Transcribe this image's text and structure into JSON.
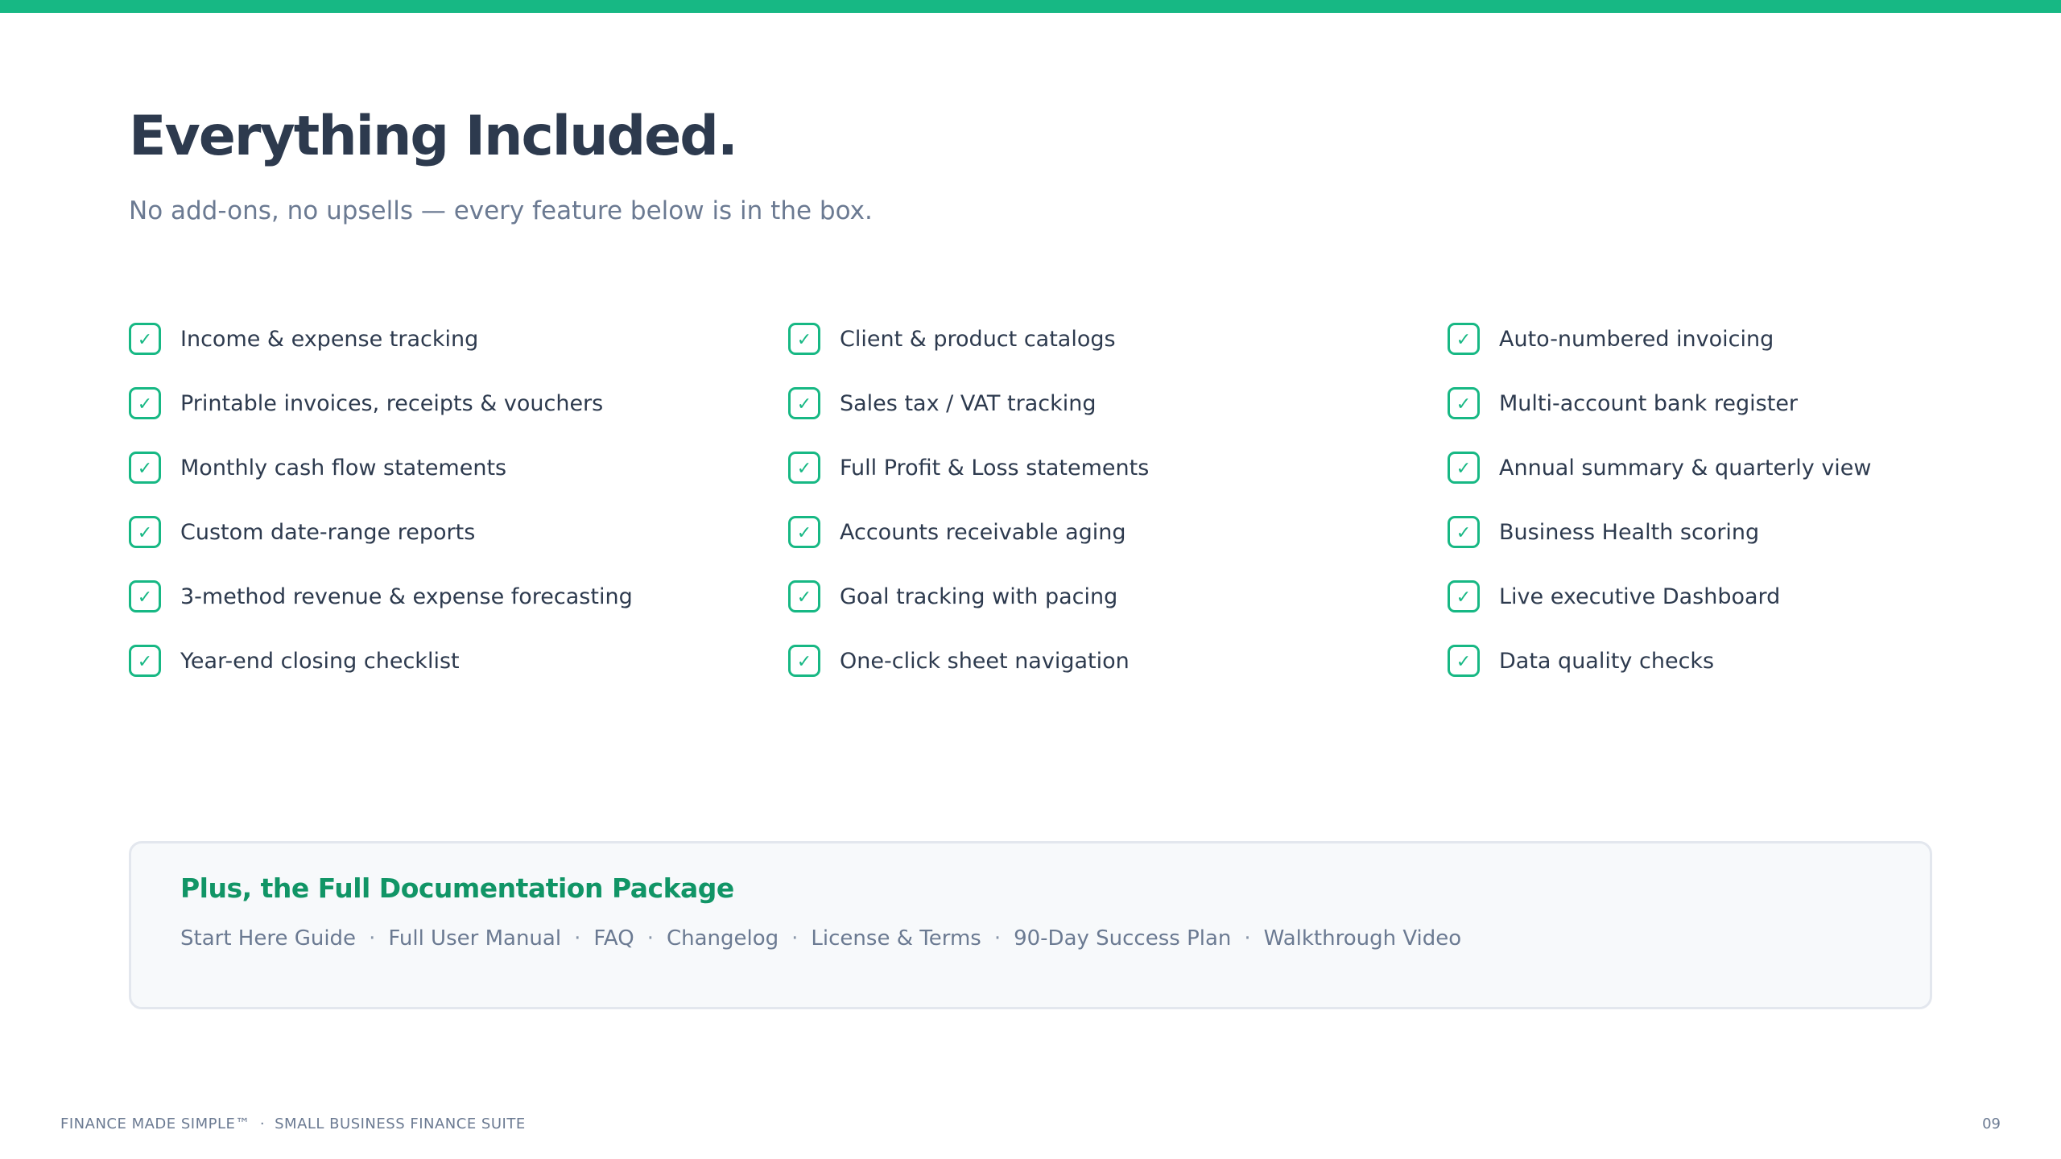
{
  "header": {
    "title": "Everything Included.",
    "subtitle": "No add-ons, no upsells — every feature below is in the box."
  },
  "features": {
    "check_glyph": "✓",
    "items": [
      "Income & expense tracking",
      "Client & product catalogs",
      "Auto-numbered invoicing",
      "Printable invoices, receipts & vouchers",
      "Sales tax / VAT tracking",
      "Multi-account bank register",
      "Monthly cash flow statements",
      "Full Profit & Loss statements",
      "Annual summary & quarterly view",
      "Custom date-range reports",
      "Accounts receivable aging",
      "Business Health scoring",
      "3-method revenue & expense forecasting",
      "Goal tracking with pacing",
      "Live executive Dashboard",
      "Year-end closing checklist",
      "One-click sheet navigation",
      "Data quality checks"
    ]
  },
  "documentation": {
    "title": "Plus, the Full Documentation Package",
    "separator": "·",
    "items": [
      "Start Here Guide",
      "Full User Manual",
      "FAQ",
      "Changelog",
      "License & Terms",
      "90-Day Success Plan",
      "Walkthrough Video"
    ]
  },
  "footer": {
    "brand": "FINANCE MADE SIMPLE™",
    "separator": "·",
    "product": "SMALL BUSINESS FINANCE SUITE",
    "page_number": "09"
  },
  "colors": {
    "accent": "#17b884",
    "accent_dark": "#119566",
    "heading": "#2d3a4e",
    "muted": "#6b7a92"
  }
}
